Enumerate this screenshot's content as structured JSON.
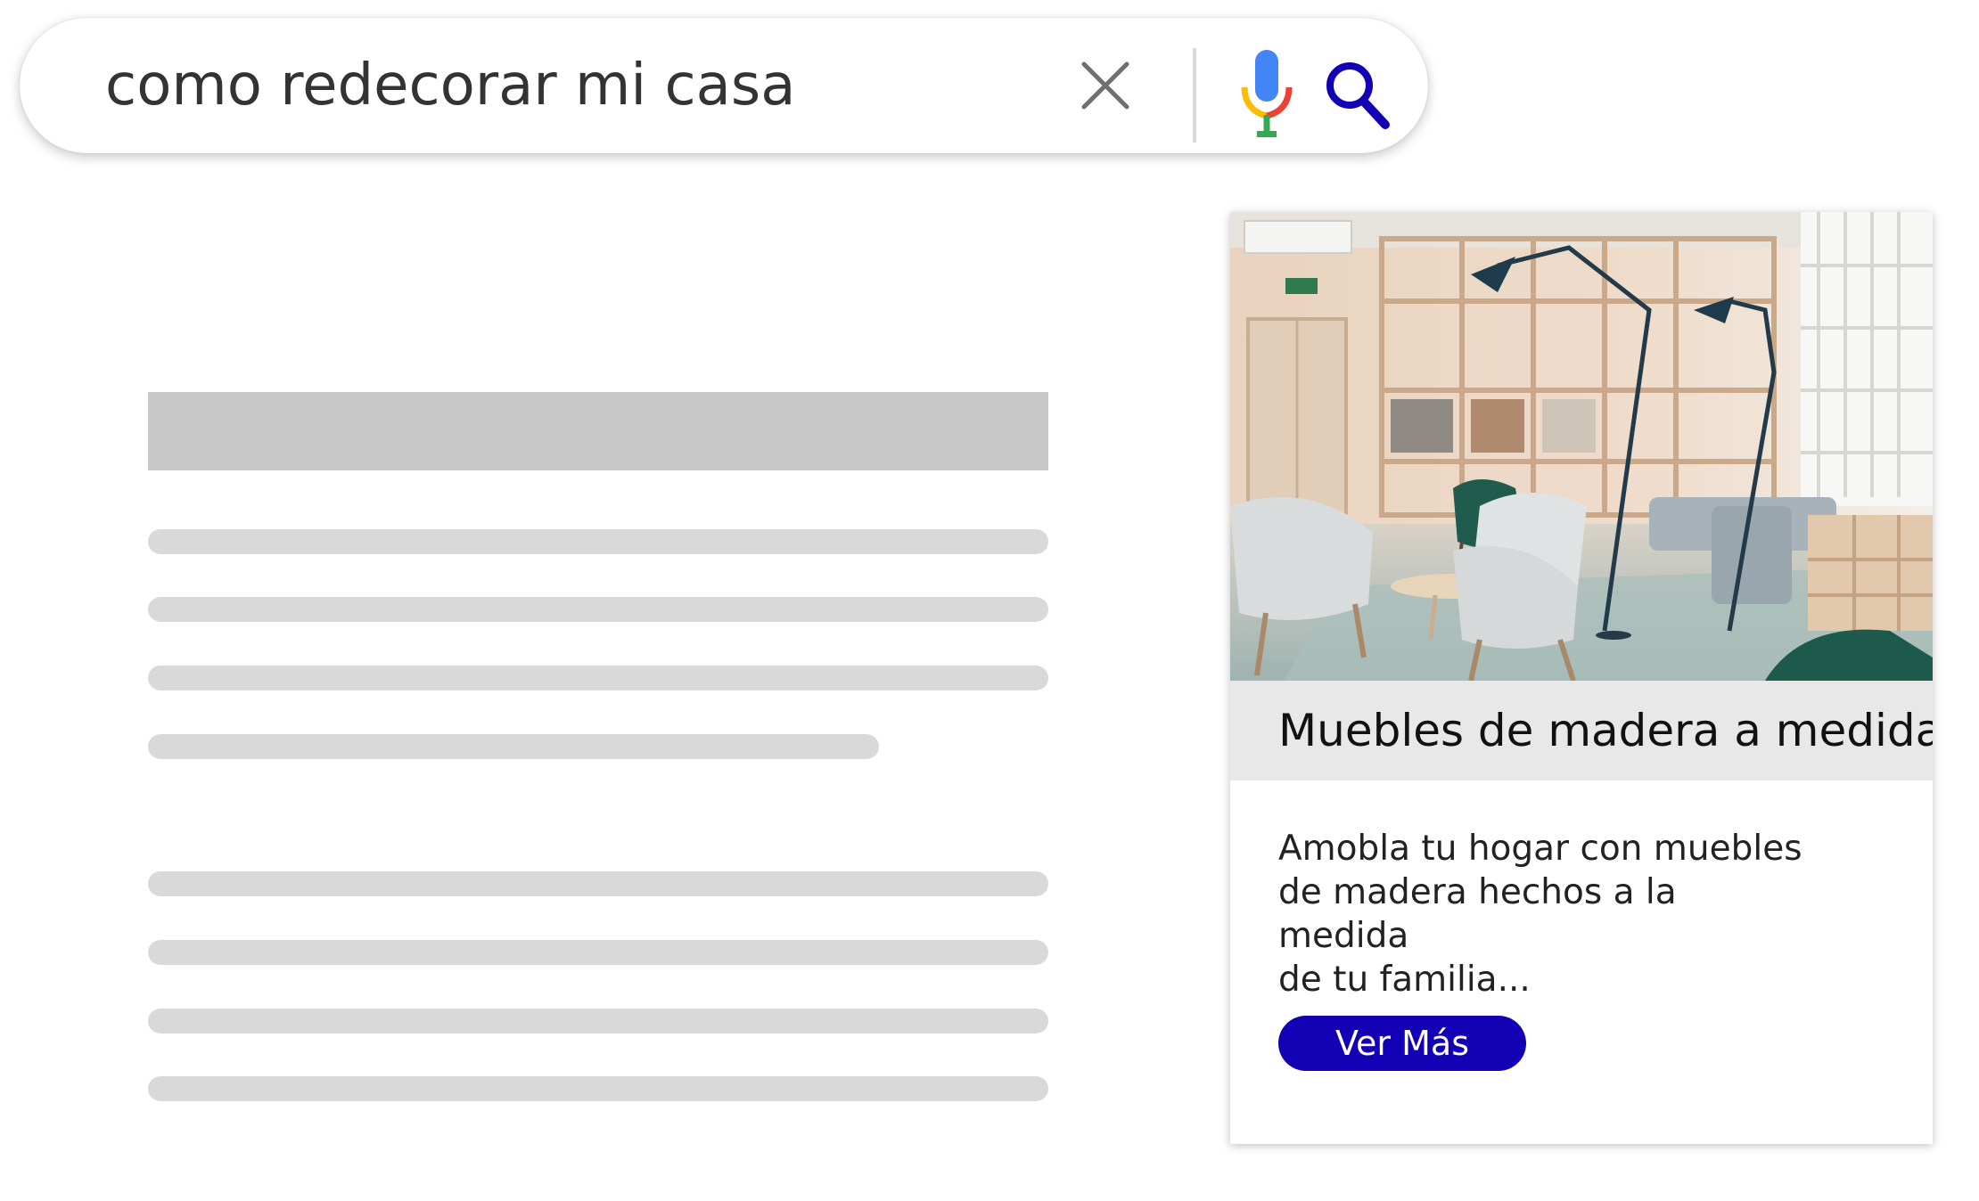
{
  "search": {
    "query": "como redecorar mi casa"
  },
  "icons": {
    "clear": "close-icon",
    "mic": "microphone-icon",
    "search": "search-icon"
  },
  "ad": {
    "title": "Muebles de madera a medida",
    "description": "Amobla tu hogar con  muebles\nde madera hechos a la medida\nde tu familia...",
    "button_label": "Ver Más",
    "image": "living-room-photo"
  },
  "colors": {
    "accent": "#1400b4",
    "mic_blue": "#4285f4",
    "mic_red": "#ea4335",
    "mic_yellow": "#fbbc05",
    "mic_green": "#34a853",
    "placeholder_dark": "#c7c7c7",
    "placeholder_light": "#d9d9d9"
  }
}
